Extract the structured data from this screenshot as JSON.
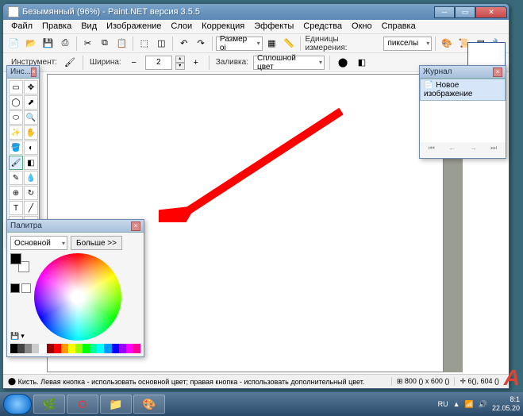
{
  "window": {
    "title": "Безымянный (96%) - Paint.NET версия 3.5.5"
  },
  "menubar": [
    "Файл",
    "Правка",
    "Вид",
    "Изображение",
    "Слои",
    "Коррекция",
    "Эффекты",
    "Средства",
    "Окно",
    "Справка"
  ],
  "toolbar": {
    "size_label": "Размер оі",
    "units_label": "Единицы измерения:",
    "units_value": "пикселы"
  },
  "toolbar2": {
    "instrument_label": "Инструмент:",
    "width_label": "Ширина:",
    "width_value": "2",
    "fill_label": "Заливка:",
    "fill_value": "Сплошной цвет"
  },
  "panels": {
    "tools_title": "Инс...",
    "palette_title": "Палитра",
    "palette_primary": "Основной",
    "palette_more": "Больше >>",
    "history_title": "Журнал",
    "history_item": "Новое изображение"
  },
  "status": {
    "hint": "Кисть. Левая кнопка - использовать основной цвет; правая кнопка - использовать дополнительный цвет.",
    "coords": "800 () x 600 ()",
    "cursor": "6(), 604 ()"
  },
  "taskbar": {
    "lang": "RU",
    "time": "8:1",
    "date": "22.05.20"
  },
  "palette_strip": [
    "#000",
    "#444",
    "#888",
    "#ccc",
    "#fff",
    "#900",
    "#f00",
    "#f90",
    "#ff0",
    "#9f0",
    "#0f0",
    "#0f9",
    "#0ff",
    "#09f",
    "#00f",
    "#90f",
    "#f0f",
    "#f09"
  ]
}
